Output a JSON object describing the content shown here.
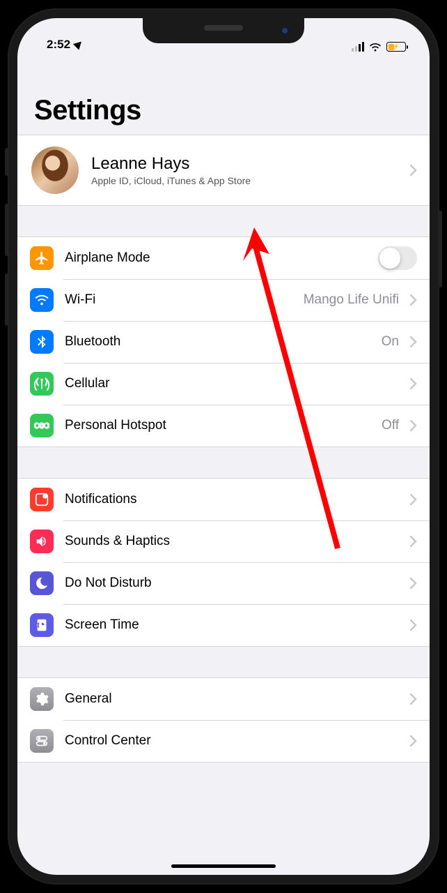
{
  "status": {
    "time": "2:52",
    "battery_percent": 38,
    "battery_color": "#ffb020"
  },
  "header": {
    "title": "Settings"
  },
  "profile": {
    "name": "Leanne Hays",
    "subtitle": "Apple ID, iCloud, iTunes & App Store"
  },
  "group_connect": {
    "airplane": {
      "label": "Airplane Mode",
      "on": false
    },
    "wifi": {
      "label": "Wi-Fi",
      "value": "Mango Life Unifi"
    },
    "bluetooth": {
      "label": "Bluetooth",
      "value": "On"
    },
    "cellular": {
      "label": "Cellular"
    },
    "hotspot": {
      "label": "Personal Hotspot",
      "value": "Off"
    }
  },
  "group_notif": {
    "notifications": {
      "label": "Notifications"
    },
    "sounds": {
      "label": "Sounds & Haptics"
    },
    "dnd": {
      "label": "Do Not Disturb"
    },
    "screentime": {
      "label": "Screen Time"
    }
  },
  "group_general": {
    "general": {
      "label": "General"
    },
    "control": {
      "label": "Control Center"
    }
  }
}
